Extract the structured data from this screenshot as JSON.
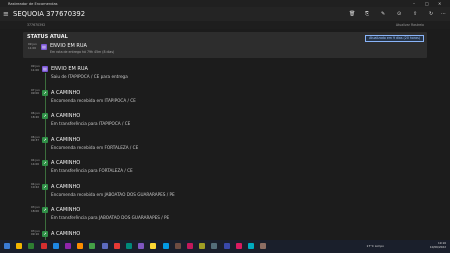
{
  "window": {
    "title": "Rastreador de Encomendas"
  },
  "header": {
    "title": "SEQUOIA 377670392"
  },
  "subheader": {
    "left": "377670392",
    "right": "Atualizar Rastreio"
  },
  "status": {
    "label": "STATUS ATUAL",
    "button": "Atualizado em 9 dias (20 horas)",
    "time": [
      "09 jun",
      "11:00"
    ],
    "title": "ENVIO EM RUA",
    "subtitle": "Em rota de entrega há 79h 45m (8 dias)"
  },
  "events": [
    {
      "time": [
        "09 jun",
        "11:00"
      ],
      "title": "ENVIO EM RUA",
      "desc": "Saiu de ITAPIPOCA / CE para entrega",
      "color": "purple",
      "icon": "truck-icon"
    },
    {
      "time": [
        "07 jun",
        "09:00"
      ],
      "title": "A CAMINHO",
      "desc": "Encomenda recebida em ITAPIPOCA / CE",
      "color": "green",
      "icon": "arrow-icon"
    },
    {
      "time": [
        "06 jun",
        "18:20"
      ],
      "title": "A CAMINHO",
      "desc": "Em transferência para ITAPIPOCA / CE",
      "color": "green",
      "icon": "arrow-icon"
    },
    {
      "time": [
        "06 jun",
        "09:37"
      ],
      "title": "A CAMINHO",
      "desc": "Encomenda recebida em FORTALEZA / CE",
      "color": "green",
      "icon": "arrow-icon"
    },
    {
      "time": [
        "04 jun",
        "14:00"
      ],
      "title": "A CAMINHO",
      "desc": "Em transferência para FORTALEZA / CE",
      "color": "green",
      "icon": "arrow-icon"
    },
    {
      "time": [
        "04 jun",
        "10:22"
      ],
      "title": "A CAMINHO",
      "desc": "Encomenda recebida em JABOATAO DOS GUARARAPES / PE",
      "color": "green",
      "icon": "arrow-icon"
    },
    {
      "time": [
        "03 jun",
        "18:00"
      ],
      "title": "A CAMINHO",
      "desc": "Em transferência para JABOATAO DOS GUARARAPES / PE",
      "color": "green",
      "icon": "arrow-icon"
    },
    {
      "time": [
        "03 jun",
        "09:10"
      ],
      "title": "A CAMINHO",
      "desc": "",
      "color": "green",
      "icon": "arrow-icon"
    }
  ],
  "taskbar": {
    "weather": "17°C  Limpo",
    "time": "19:16",
    "date": "10/06/2022"
  }
}
